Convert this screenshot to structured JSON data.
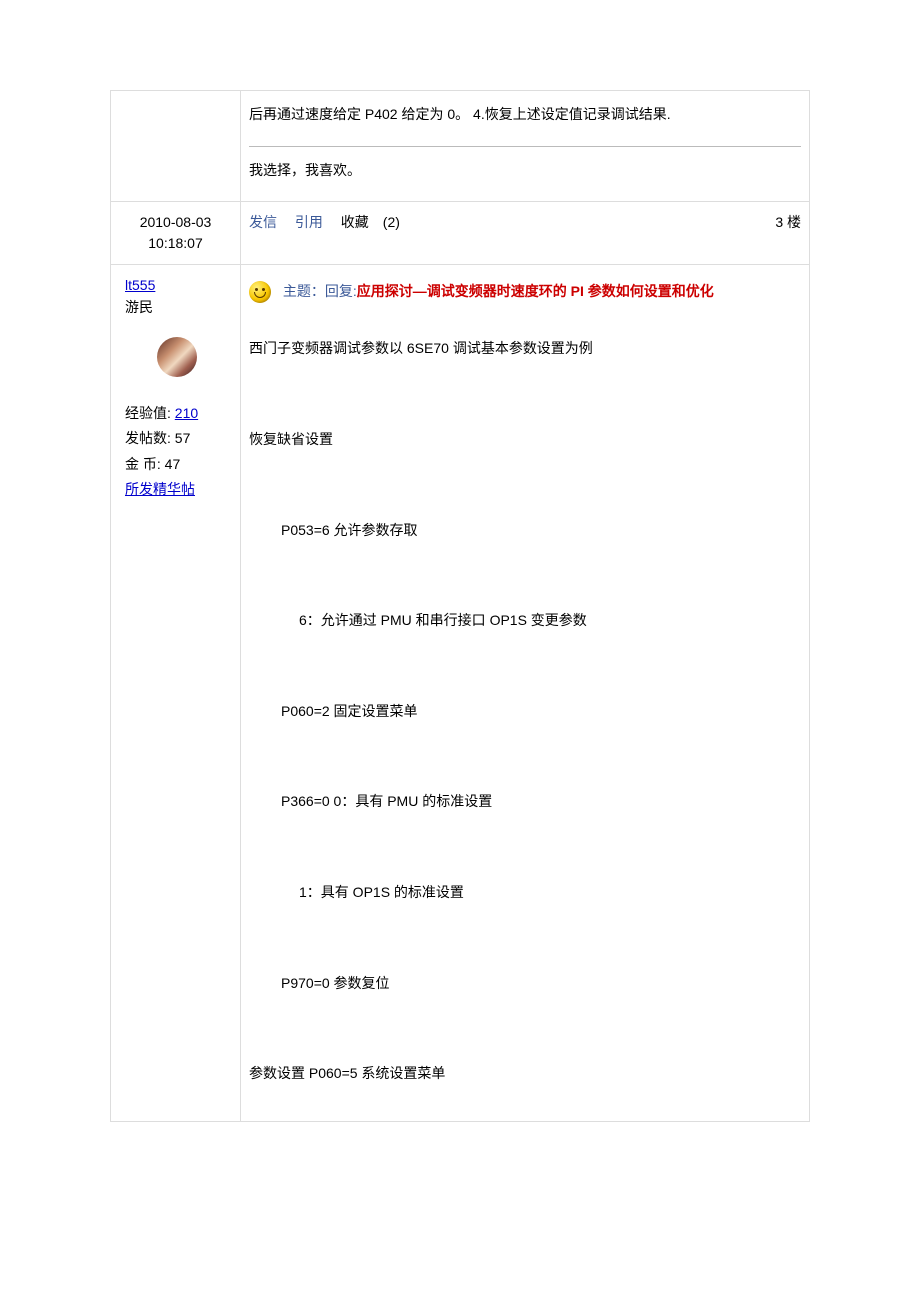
{
  "prev_post": {
    "tail_text": "后再通过速度给定 P402 给定为 0。 4.恢复上述设定值记录调试结果.",
    "signature": "我选择，我喜欢。",
    "timestamp_date": "2010-08-03",
    "timestamp_time": "10:18:07",
    "actions": {
      "send_msg": "发信",
      "quote": "引用",
      "favorite_label": "收藏",
      "favorite_count": "(2)"
    },
    "floor": "3 楼"
  },
  "post": {
    "user": {
      "name": "lt555",
      "rank": "游民",
      "exp_label": "经验值:",
      "exp_value": "210",
      "posts_label": "发帖数:",
      "posts_value": "57",
      "coins_label": "金   币:",
      "coins_value": "47",
      "elite_posts": "所发精华帖"
    },
    "subject": {
      "label": "主题：",
      "reply": "回复:",
      "title": "应用探讨—调试变频器时速度环的 PI 参数如何设置和优化"
    },
    "body": {
      "intro": "西门子变频器调试参数以 6SE70 调试基本参数设置为例",
      "restore_defaults": "恢复缺省设置",
      "p053": "P053=6    允许参数存取",
      "p053_desc": "6：允许通过 PMU 和串行接口 OP1S 变更参数",
      "p060_2": "P060=2    固定设置菜单",
      "p366": "P366=0    0：具有 PMU 的标准设置",
      "p366_1": "1：具有 OP1S 的标准设置",
      "p970": "P970=0    参数复位",
      "param_setting": "参数设置    P060=5    系统设置菜单"
    }
  }
}
